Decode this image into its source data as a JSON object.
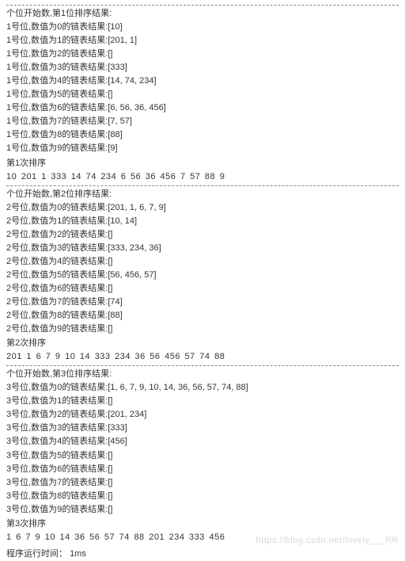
{
  "passes": [
    {
      "title": "个位开始数,第1位排序结果:",
      "pass_prefix": "1",
      "buckets": [
        "[10]",
        "[201, 1]",
        "[]",
        "[333]",
        "[14, 74, 234]",
        "[]",
        "[6, 56, 36, 456]",
        "[7, 57]",
        "[88]",
        "[9]"
      ],
      "sort_label": "第1次排序",
      "sort_result": "10  201  1  333  14  74  234  6  56  36  456  7  57  88  9"
    },
    {
      "title": "个位开始数,第2位排序结果:",
      "pass_prefix": "2",
      "buckets": [
        "[201, 1, 6, 7, 9]",
        "[10, 14]",
        "[]",
        "[333, 234, 36]",
        "[]",
        "[56, 456, 57]",
        "[]",
        "[74]",
        "[88]",
        "[]"
      ],
      "sort_label": "第2次排序",
      "sort_result": "201  1  6  7  9  10  14  333  234  36  56  456  57  74  88"
    },
    {
      "title": "个位开始数,第3位排序结果:",
      "pass_prefix": "3",
      "buckets": [
        "[1, 6, 7, 9, 10, 14, 36, 56, 57, 74, 88]",
        "[]",
        "[201, 234]",
        "[333]",
        "[456]",
        "[]",
        "[]",
        "[]",
        "[]",
        "[]"
      ],
      "sort_label": "第3次排序",
      "sort_result": "1  6  7  9  10  14  36  56  57  74  88  201  234  333  456"
    }
  ],
  "line_label_template": {
    "middle": "号位,数值为",
    "suffix": "的链表结果:"
  },
  "runtime_label": "程序运行时间：",
  "runtime_value": "1ms",
  "watermark": "https://blog.csdn.net/lovely___RR"
}
